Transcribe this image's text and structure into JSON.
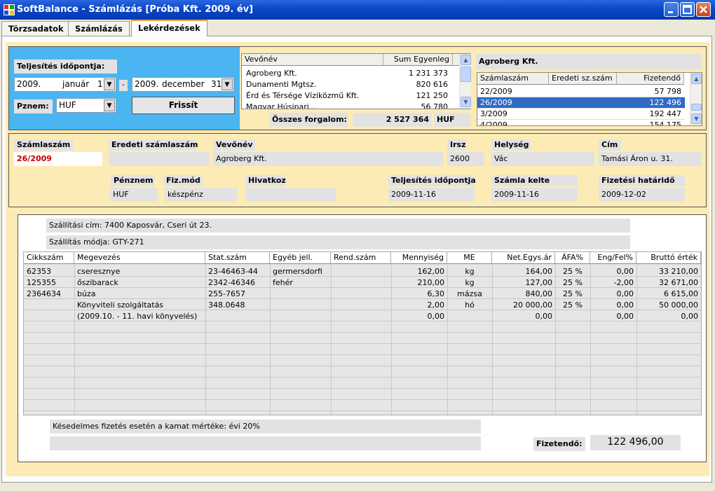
{
  "window": {
    "title": "SoftBalance - Számlázás   [Próba Kft.   2009. év]"
  },
  "tabs": [
    "Törzsadatok",
    "Számlázás",
    "Lekérdezések"
  ],
  "filter": {
    "period_label": "Teljesítés időpontja:",
    "from_year": "2009.",
    "from_month": "január",
    "from_day": "1",
    "dash": "-",
    "to_year": "2009.",
    "to_month": "december",
    "to_day": "31",
    "currency_label": "Pznem:",
    "currency_value": "HUF",
    "refresh_label": "Frissít"
  },
  "customers": {
    "col_name": "Vevőnév",
    "col_sum": "Sum Egyenleg",
    "rows": [
      {
        "name": "Agroberg Kft.",
        "sum": "1 231 373"
      },
      {
        "name": "Dunamenti Mgtsz.",
        "sum": "820 616"
      },
      {
        "name": "Érd és Térsége Víziközmű Kft.",
        "sum": "121 250"
      },
      {
        "name": "Magyar Húsipari...",
        "sum": "56 780"
      }
    ],
    "total_label": "Összes forgalom:",
    "total_value": "2 527 364",
    "total_currency": "HUF"
  },
  "invoices": {
    "customer": "Agroberg Kft.",
    "col_no": "Számlaszám",
    "col_orig": "Eredeti sz.szám",
    "col_pay": "Fizetendő",
    "rows": [
      {
        "no": "22/2009",
        "orig": "",
        "pay": "57 798"
      },
      {
        "no": "26/2009",
        "orig": "",
        "pay": "122 496"
      },
      {
        "no": "3/2009",
        "orig": "",
        "pay": "192 447"
      },
      {
        "no": "4/2009",
        "orig": "",
        "pay": "154 175"
      }
    ]
  },
  "header": {
    "no_label": "Számlaszám",
    "no_value": "26/2009",
    "orig_label": "Eredeti számlaszám",
    "orig_value": "",
    "cust_label": "Vevőnév",
    "cust_value": "Agroberg Kft.",
    "zip_label": "Irsz",
    "zip_value": "2600",
    "city_label": "Helység",
    "city_value": "Vác",
    "addr_label": "Cím",
    "addr_value": "Tamási Áron u. 31.",
    "curr_label": "Pénznem",
    "curr_value": "HUF",
    "paym_label": "Fiz.mód",
    "paym_value": "készpénz",
    "ref_label": "Hivatkoz",
    "ref_value": "",
    "perf_label": "Teljesítés időpontja",
    "perf_value": "2009-11-16",
    "issue_label": "Számla kelte",
    "issue_value": "2009-11-16",
    "due_label": "Fizetési határidő",
    "due_value": "2009-12-02"
  },
  "detail": {
    "ship_addr": "Szállítási cím:  7400 Kaposvár, Cseri út 23.",
    "ship_mode": "Szállítás módja:  GTY-271",
    "columns": [
      "Cikkszám",
      "Megevezés",
      "Stat.szám",
      "Egyéb jell.",
      "Rend.szám",
      "Mennyiség",
      "ME",
      "Net.Egys.ár",
      "ÁFA%",
      "Eng/Fel%",
      "Bruttó érték"
    ],
    "rows": [
      [
        "62353",
        "cseresznye",
        "23-46463-44",
        "germersdorfi",
        "",
        "162,00",
        "kg",
        "164,00",
        "25 %",
        "0,00",
        "33 210,00"
      ],
      [
        "125355",
        "őszibarack",
        "2342-46346",
        "fehér",
        "",
        "210,00",
        "kg",
        "127,00",
        "25 %",
        "-2,00",
        "32 671,00"
      ],
      [
        "2364634",
        "búza",
        "255-7657",
        "",
        "",
        "6,30",
        "mázsa",
        "840,00",
        "25 %",
        "0,00",
        "6 615,00"
      ],
      [
        "",
        "Könyviteli szolgáltatás",
        "348.0648",
        "",
        "",
        "2,00",
        "hó",
        "20 000,00",
        "25 %",
        "0,00",
        "50 000,00"
      ],
      [
        "",
        "(2009.10. - 11. havi könyvelés)",
        "",
        "",
        "",
        "0,00",
        "",
        "0,00",
        "",
        "0,00",
        "0,00"
      ]
    ],
    "note1": "Késedelmes fizetés esetén a kamat mértéke: évi 20%",
    "note2": "",
    "total_label": "Fizetendő:",
    "total_value": "122 496,00"
  },
  "colors": {
    "panel_blue": "#4BB5F1",
    "panel_cream": "#FDEBB6",
    "selected_row": "#316AC5",
    "red_value": "#C00000"
  }
}
